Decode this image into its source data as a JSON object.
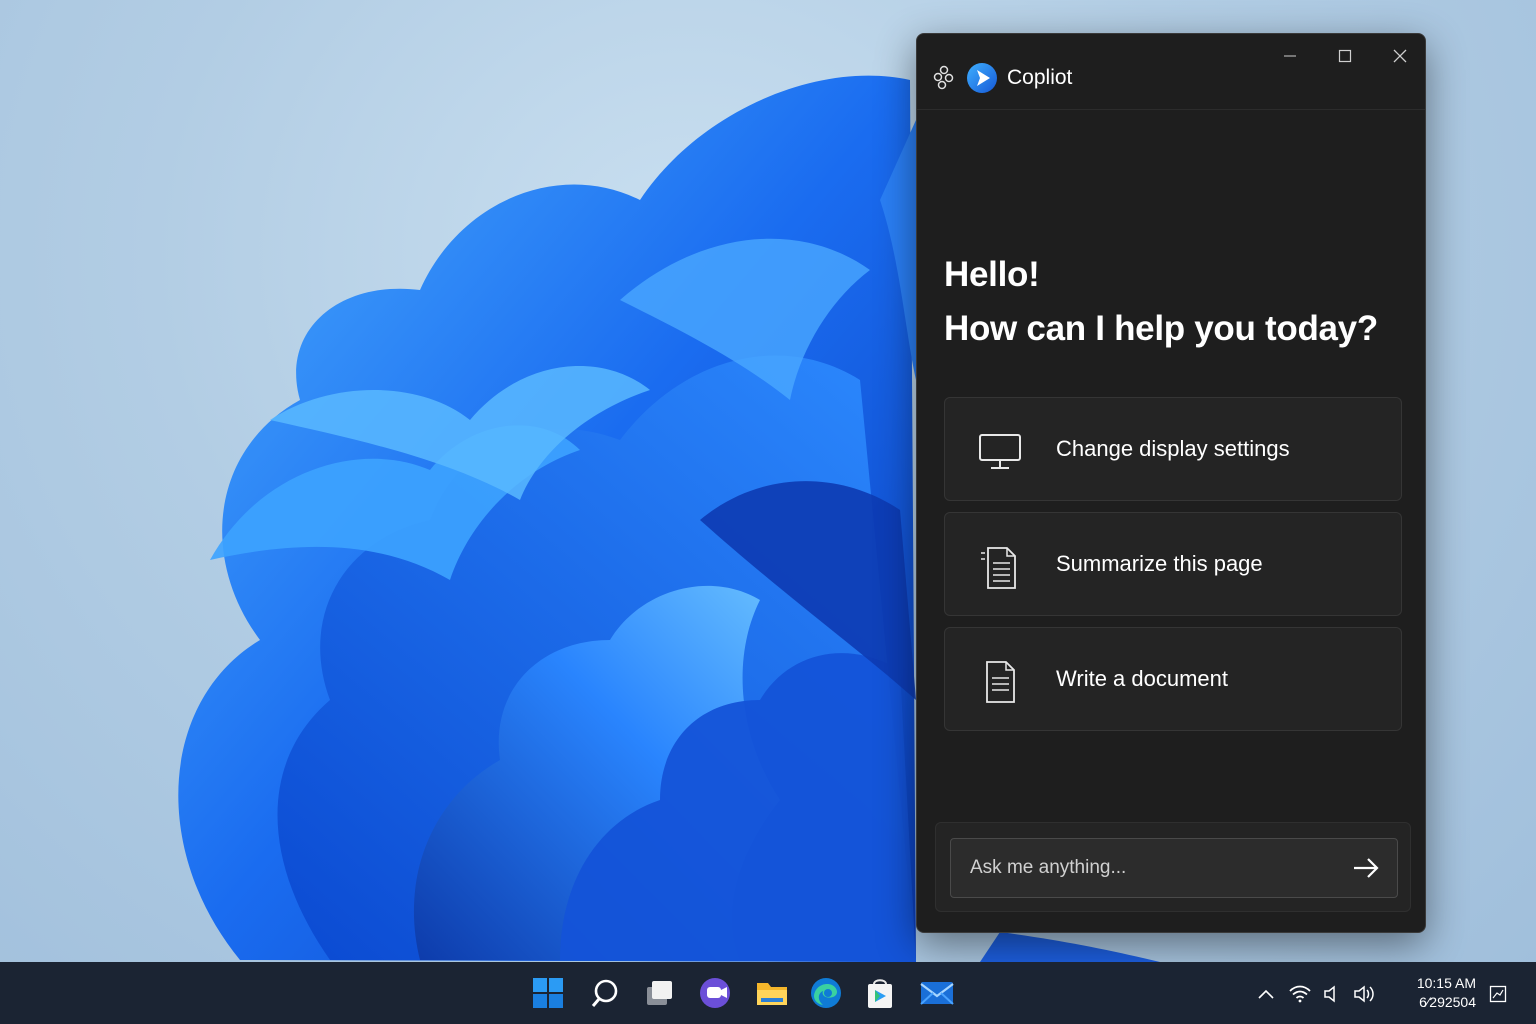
{
  "copilot": {
    "app_title": "Copliot",
    "greeting_line1": "Hello!",
    "greeting_line2": "How can I help you today?",
    "suggestions": [
      {
        "label": "Change display settings",
        "icon": "monitor-icon"
      },
      {
        "label": "Summarize this page",
        "icon": "notes-icon"
      },
      {
        "label": "Write a document",
        "icon": "document-icon"
      }
    ],
    "input_placeholder": "Ask me anything...",
    "send_icon": "arrow-right-icon"
  },
  "window_controls": [
    "minimize-icon",
    "maximize-icon",
    "close-icon"
  ],
  "taskbar": {
    "apps": [
      "windows-start-icon",
      "search-icon",
      "task-view-icon",
      "chat-icon",
      "file-explorer-icon",
      "edge-icon",
      "store-icon",
      "mail-icon"
    ],
    "tray": [
      "chevron-up-icon",
      "wifi-icon",
      "speaker-icon",
      "volume-icon"
    ],
    "time": "10:15 AM",
    "date": "6⁄292504",
    "notification_icon": "notification-icon"
  },
  "colors": {
    "accent": "#1a78f2",
    "window_bg": "#1e1e1e",
    "card_bg": "#242424",
    "taskbar_bg": "#1b2433"
  }
}
